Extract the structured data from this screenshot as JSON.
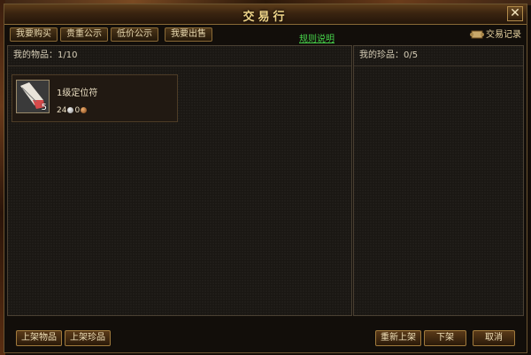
{
  "window": {
    "title": "交易行"
  },
  "tabs": [
    {
      "label": "我要购买"
    },
    {
      "label": "贵重公示"
    },
    {
      "label": "低价公示"
    },
    {
      "label": "我要出售"
    }
  ],
  "rules_link": "规则说明",
  "trade_log": "交易记录",
  "my_items": {
    "header": "我的物品：1/10",
    "items": [
      {
        "name": "1级定位符",
        "quantity": "5",
        "price_silver": "24",
        "price_copper": "0"
      }
    ]
  },
  "my_treasures": {
    "header": "我的珍品：0/5"
  },
  "buttons": {
    "list_item": "上架物品",
    "list_treasure": "上架珍品",
    "relist": "重新上架",
    "delist": "下架",
    "cancel": "取消"
  },
  "colors": {
    "title_gold": "#f1d68a",
    "link_green": "#46d04a",
    "border_bronze": "#8a6a36",
    "panel_bg": "#1a1713"
  },
  "icons": [
    "close-icon",
    "scroll-icon",
    "talisman-icon",
    "silver-coin-icon",
    "copper-coin-icon"
  ]
}
